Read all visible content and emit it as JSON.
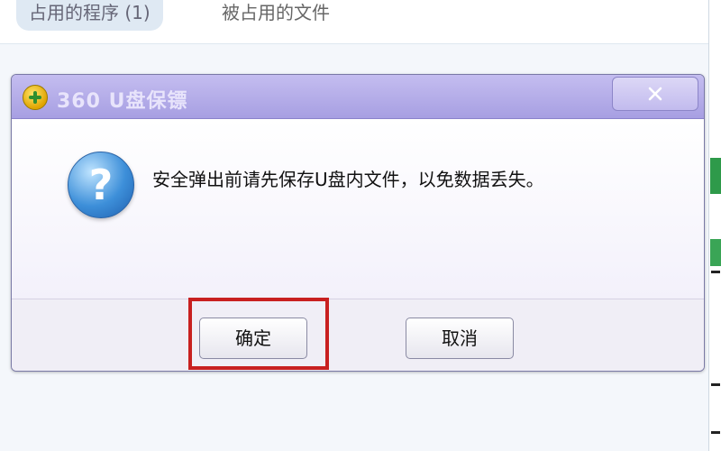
{
  "background": {
    "tabs": [
      {
        "label": "占用的程序 (1)",
        "active": true
      },
      {
        "label": "被占用的文件",
        "active": false
      }
    ]
  },
  "dialog": {
    "title": "360 U盘保镖",
    "close_label": "×",
    "icon": "question-icon",
    "message": "安全弹出前请先保存U盘内文件，以免数据丢失。",
    "ok_label": "确定",
    "cancel_label": "取消"
  },
  "colors": {
    "titlebar": "#b3acea",
    "highlight": "#c82020",
    "accent": "#3d8fd9"
  }
}
